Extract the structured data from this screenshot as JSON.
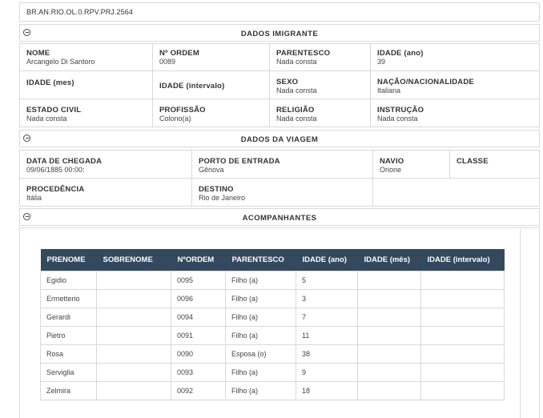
{
  "reference": "BR.AN.RIO.OL.0.RPV.PRJ.2564",
  "dados_imigrante": {
    "title": "DADOS IMIGRANTE",
    "nome_label": "NOME",
    "nome_value": "Arcangelo Di Santoro",
    "ordem_label": "Nº ORDEM",
    "ordem_value": "0089",
    "parentesco_label": "PARENTESCO",
    "parentesco_value": "Nada consta",
    "idade_ano_label": "IDADE (ano)",
    "idade_ano_value": "39",
    "idade_mes_label": "IDADE (mes)",
    "idade_intervalo_label": "IDADE (intervalo)",
    "sexo_label": "SEXO",
    "sexo_value": "Nada consta",
    "nacao_label": "NAÇÃO/NACIONALIDADE",
    "nacao_value": "Italiana",
    "estado_civil_label": "ESTADO CIVIL",
    "estado_civil_value": "Nada consta",
    "profissao_label": "PROFISSÃO",
    "profissao_value": "Colono(a)",
    "religiao_label": "RELIGIÃO",
    "religiao_value": "Nada consta",
    "instrucao_label": "INSTRUÇÃO",
    "instrucao_value": "Nada consta"
  },
  "dados_viagem": {
    "title": "DADOS DA VIAGEM",
    "chegada_label": "DATA DE CHEGADA",
    "chegada_value": "09/06/1885 00:00:",
    "porto_label": "PORTO DE ENTRADA",
    "porto_value": "Gênova",
    "navio_label": "NAVIO",
    "navio_value": "Orione",
    "classe_label": "CLASSE",
    "procedencia_label": "PROCEDÊNCIA",
    "procedencia_value": "Itália",
    "destino_label": "DESTINO",
    "destino_value": "Rio de Janeiro"
  },
  "acompanhantes": {
    "title": "ACOMPANHANTES",
    "columns": [
      "PRENOME",
      "SOBRENOME",
      "NºORDEM",
      "PARENTESCO",
      "IDADE (ano)",
      "IDADE (mês)",
      "IDADE (intervalo)"
    ],
    "rows": [
      [
        "Egidio",
        "",
        "0095",
        "Filho (a)",
        "5",
        "",
        ""
      ],
      [
        "Ermetterio",
        "",
        "0096",
        "Filho (a)",
        "3",
        "",
        ""
      ],
      [
        "Gerardi",
        "",
        "0094",
        "Filho (a)",
        "7",
        "",
        ""
      ],
      [
        "Pietro",
        "",
        "0091",
        "Filho (a)",
        "11",
        "",
        ""
      ],
      [
        "Rosa",
        "",
        "0090",
        "Esposa (o)",
        "38",
        "",
        ""
      ],
      [
        "Serviglia",
        "",
        "0093",
        "Filho (a)",
        "9",
        "",
        ""
      ],
      [
        "Zelmira",
        "",
        "0092",
        "Filho (a)",
        "18",
        "",
        ""
      ]
    ]
  },
  "colors": {
    "table_header_bg": "#34495e",
    "border": "#d9d9d9"
  }
}
